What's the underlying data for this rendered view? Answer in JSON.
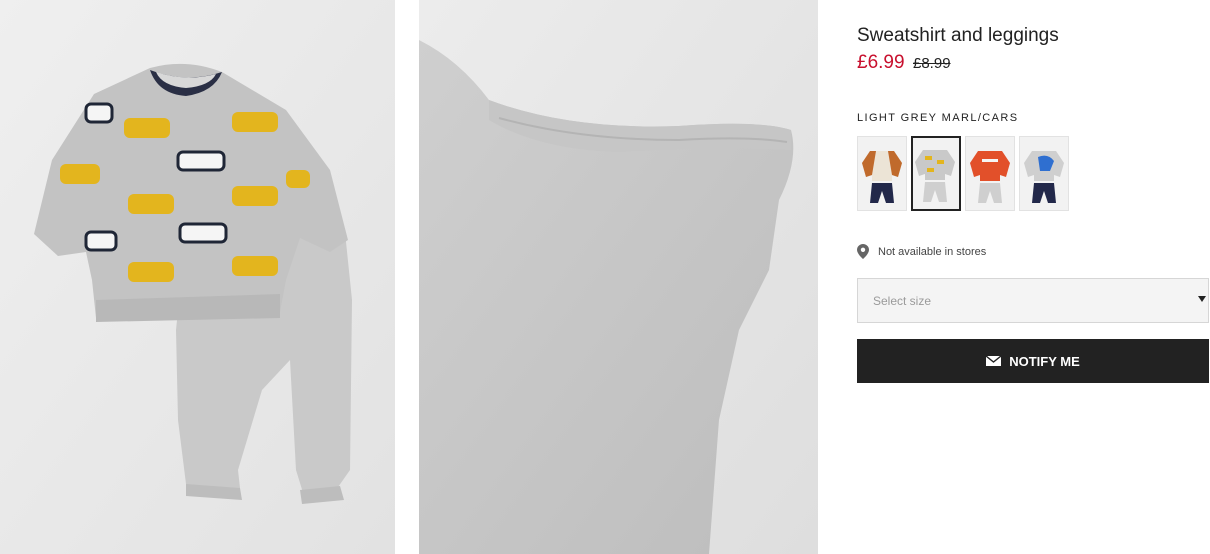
{
  "product": {
    "title": "Sweatshirt and leggings",
    "price_sale": "£6.99",
    "price_original": "£8.99",
    "sale_color": "#c8102e"
  },
  "gallery": {
    "images": [
      {
        "name": "product-image-outfit",
        "alt": "Grey sweatshirt with taxi and police car print and grey leggings"
      },
      {
        "name": "product-image-leggings-detail",
        "alt": "Close-up of grey leggings waistband"
      }
    ]
  },
  "color": {
    "selected_label": "LIGHT GREY MARL/CARS",
    "swatches": [
      {
        "name": "navy-orange-set",
        "selected": false
      },
      {
        "name": "light-grey-marl-cars",
        "selected": true
      },
      {
        "name": "orange-athletic-set",
        "selected": false
      },
      {
        "name": "grey-dinosaur-set",
        "selected": false
      }
    ]
  },
  "availability": {
    "icon": "location-pin-icon",
    "text": "Not available in stores"
  },
  "size_select": {
    "placeholder": "Select size",
    "icon": "chevron-down-icon"
  },
  "notify_button": {
    "label": "NOTIFY ME",
    "icon": "envelope-icon",
    "background": "#222222"
  }
}
